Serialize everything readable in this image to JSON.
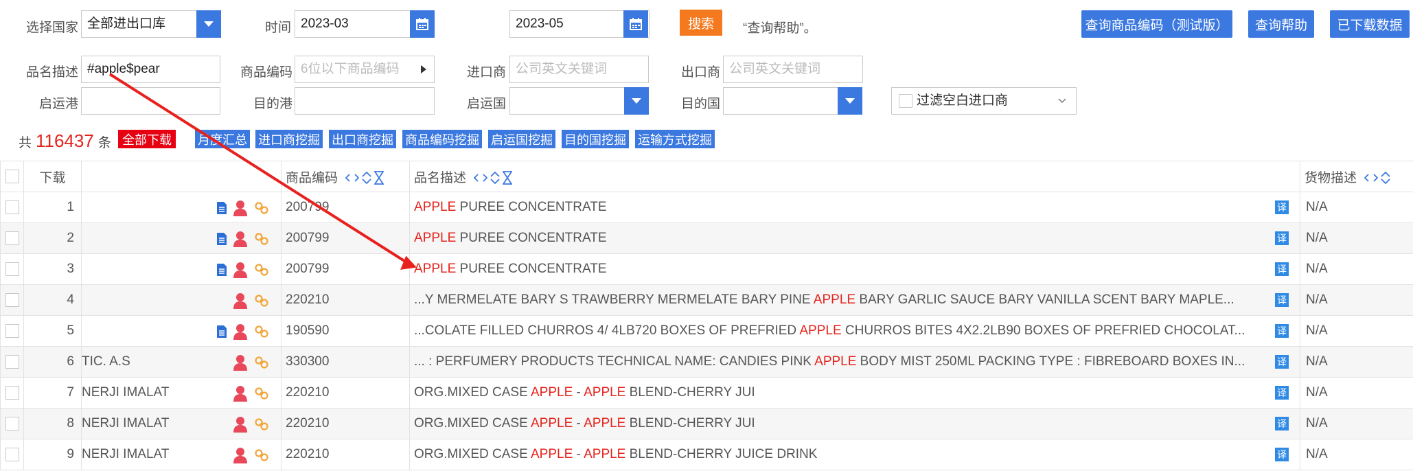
{
  "search": {
    "country_label": "选择国家",
    "country_value": "全部进出口库",
    "time_label": "时间",
    "time_from": "2023-03",
    "time_to": "2023-05",
    "search_button": "搜索",
    "help_text": "“查询帮助”。",
    "product_desc_label": "品名描述",
    "product_desc_value": "#apple$pear",
    "hs_code_label": "商品编码",
    "hs_code_placeholder": "6位以下商品编码",
    "importer_label": "进口商",
    "importer_placeholder": "公司英文关键词",
    "exporter_label": "出口商",
    "exporter_placeholder": "公司英文关键词",
    "origin_port_label": "启运港",
    "dest_port_label": "目的港",
    "origin_country_label": "启运国",
    "dest_country_label": "目的国",
    "filter_blank_label": "过滤空白进口商"
  },
  "top_buttons": {
    "query_hs": "查询商品编码（测试版）",
    "query_help": "查询帮助",
    "downloaded": "已下载数据"
  },
  "summary": {
    "prefix": "共",
    "count": "116437",
    "suffix": "条",
    "download_all": "全部下载",
    "tags": [
      "月度汇总",
      "进口商挖掘",
      "出口商挖掘",
      "商品编码挖掘",
      "启运国挖掘",
      "目的国挖掘",
      "运输方式挖掘"
    ]
  },
  "table": {
    "headers": {
      "download": "下载",
      "hs_code": "商品编码",
      "product_desc": "品名描述",
      "goods_desc": "货物描述"
    },
    "translate_badge": "译",
    "rows": [
      {
        "no": "1",
        "company": "",
        "doc": true,
        "hs": "200799",
        "desc": [
          {
            "t": "APPLE",
            "h": true
          },
          {
            "t": " PUREE CONCENTRATE",
            "h": false
          }
        ],
        "goods": "N/A"
      },
      {
        "no": "2",
        "company": "",
        "doc": true,
        "hs": "200799",
        "desc": [
          {
            "t": "APPLE",
            "h": true
          },
          {
            "t": " PUREE CONCENTRATE",
            "h": false
          }
        ],
        "goods": "N/A"
      },
      {
        "no": "3",
        "company": "",
        "doc": true,
        "hs": "200799",
        "desc": [
          {
            "t": "APPLE",
            "h": true
          },
          {
            "t": " PUREE CONCENTRATE",
            "h": false
          }
        ],
        "goods": "N/A"
      },
      {
        "no": "4",
        "company": "",
        "doc": false,
        "hs": "220210",
        "desc": [
          {
            "t": "...Y MERMELATE BARY S TRAWBERRY MERMELATE BARY PINE ",
            "h": false
          },
          {
            "t": "APPLE",
            "h": true
          },
          {
            "t": " BARY GARLIC SAUCE BARY VANILLA SCENT BARY MAPLE...",
            "h": false
          }
        ],
        "goods": "N/A"
      },
      {
        "no": "5",
        "company": "",
        "doc": true,
        "hs": "190590",
        "desc": [
          {
            "t": "...COLATE FILLED CHURROS 4/ 4LB720 BOXES OF PREFRIED ",
            "h": false
          },
          {
            "t": "APPLE",
            "h": true
          },
          {
            "t": " CHURROS BITES 4X2.2LB90 BOXES OF PREFRIED CHOCOLAT...",
            "h": false
          }
        ],
        "goods": "N/A"
      },
      {
        "no": "6",
        "company": "TIC. A.S",
        "doc": false,
        "hs": "330300",
        "desc": [
          {
            "t": "... : PERFUMERY PRODUCTS TECHNICAL NAME: CANDIES PINK ",
            "h": false
          },
          {
            "t": "APPLE",
            "h": true
          },
          {
            "t": " BODY MIST 250ML PACKING TYPE : FIBREBOARD BOXES IN...",
            "h": false
          }
        ],
        "goods": "N/A"
      },
      {
        "no": "7",
        "company": "NERJI IMALAT",
        "doc": false,
        "hs": "220210",
        "desc": [
          {
            "t": "ORG.MIXED CASE ",
            "h": false
          },
          {
            "t": "APPLE",
            "h": true
          },
          {
            "t": " - ",
            "h": false
          },
          {
            "t": "APPLE",
            "h": true
          },
          {
            "t": " BLEND-CHERRY JUI",
            "h": false
          }
        ],
        "goods": "N/A"
      },
      {
        "no": "8",
        "company": "NERJI IMALAT",
        "doc": false,
        "hs": "220210",
        "desc": [
          {
            "t": "ORG.MIXED CASE ",
            "h": false
          },
          {
            "t": "APPLE",
            "h": true
          },
          {
            "t": " - ",
            "h": false
          },
          {
            "t": "APPLE",
            "h": true
          },
          {
            "t": " BLEND-CHERRY JUI",
            "h": false
          }
        ],
        "goods": "N/A"
      },
      {
        "no": "9",
        "company": "NERJI IMALAT",
        "doc": false,
        "hs": "220210",
        "desc": [
          {
            "t": "ORG.MIXED CASE ",
            "h": false
          },
          {
            "t": "APPLE",
            "h": true
          },
          {
            "t": " - ",
            "h": false
          },
          {
            "t": "APPLE",
            "h": true
          },
          {
            "t": " BLEND-CHERRY JUICE DRINK",
            "h": false
          }
        ],
        "goods": "N/A"
      }
    ]
  },
  "colors": {
    "accent_blue": "#3b78e0",
    "search_orange": "#f57a1f",
    "highlight_red": "#e5231c",
    "download_all_red": "#e60012",
    "person_icon": "#e8485a",
    "link_icon": "#f2a63a",
    "doc_icon": "#2b6fd6"
  }
}
